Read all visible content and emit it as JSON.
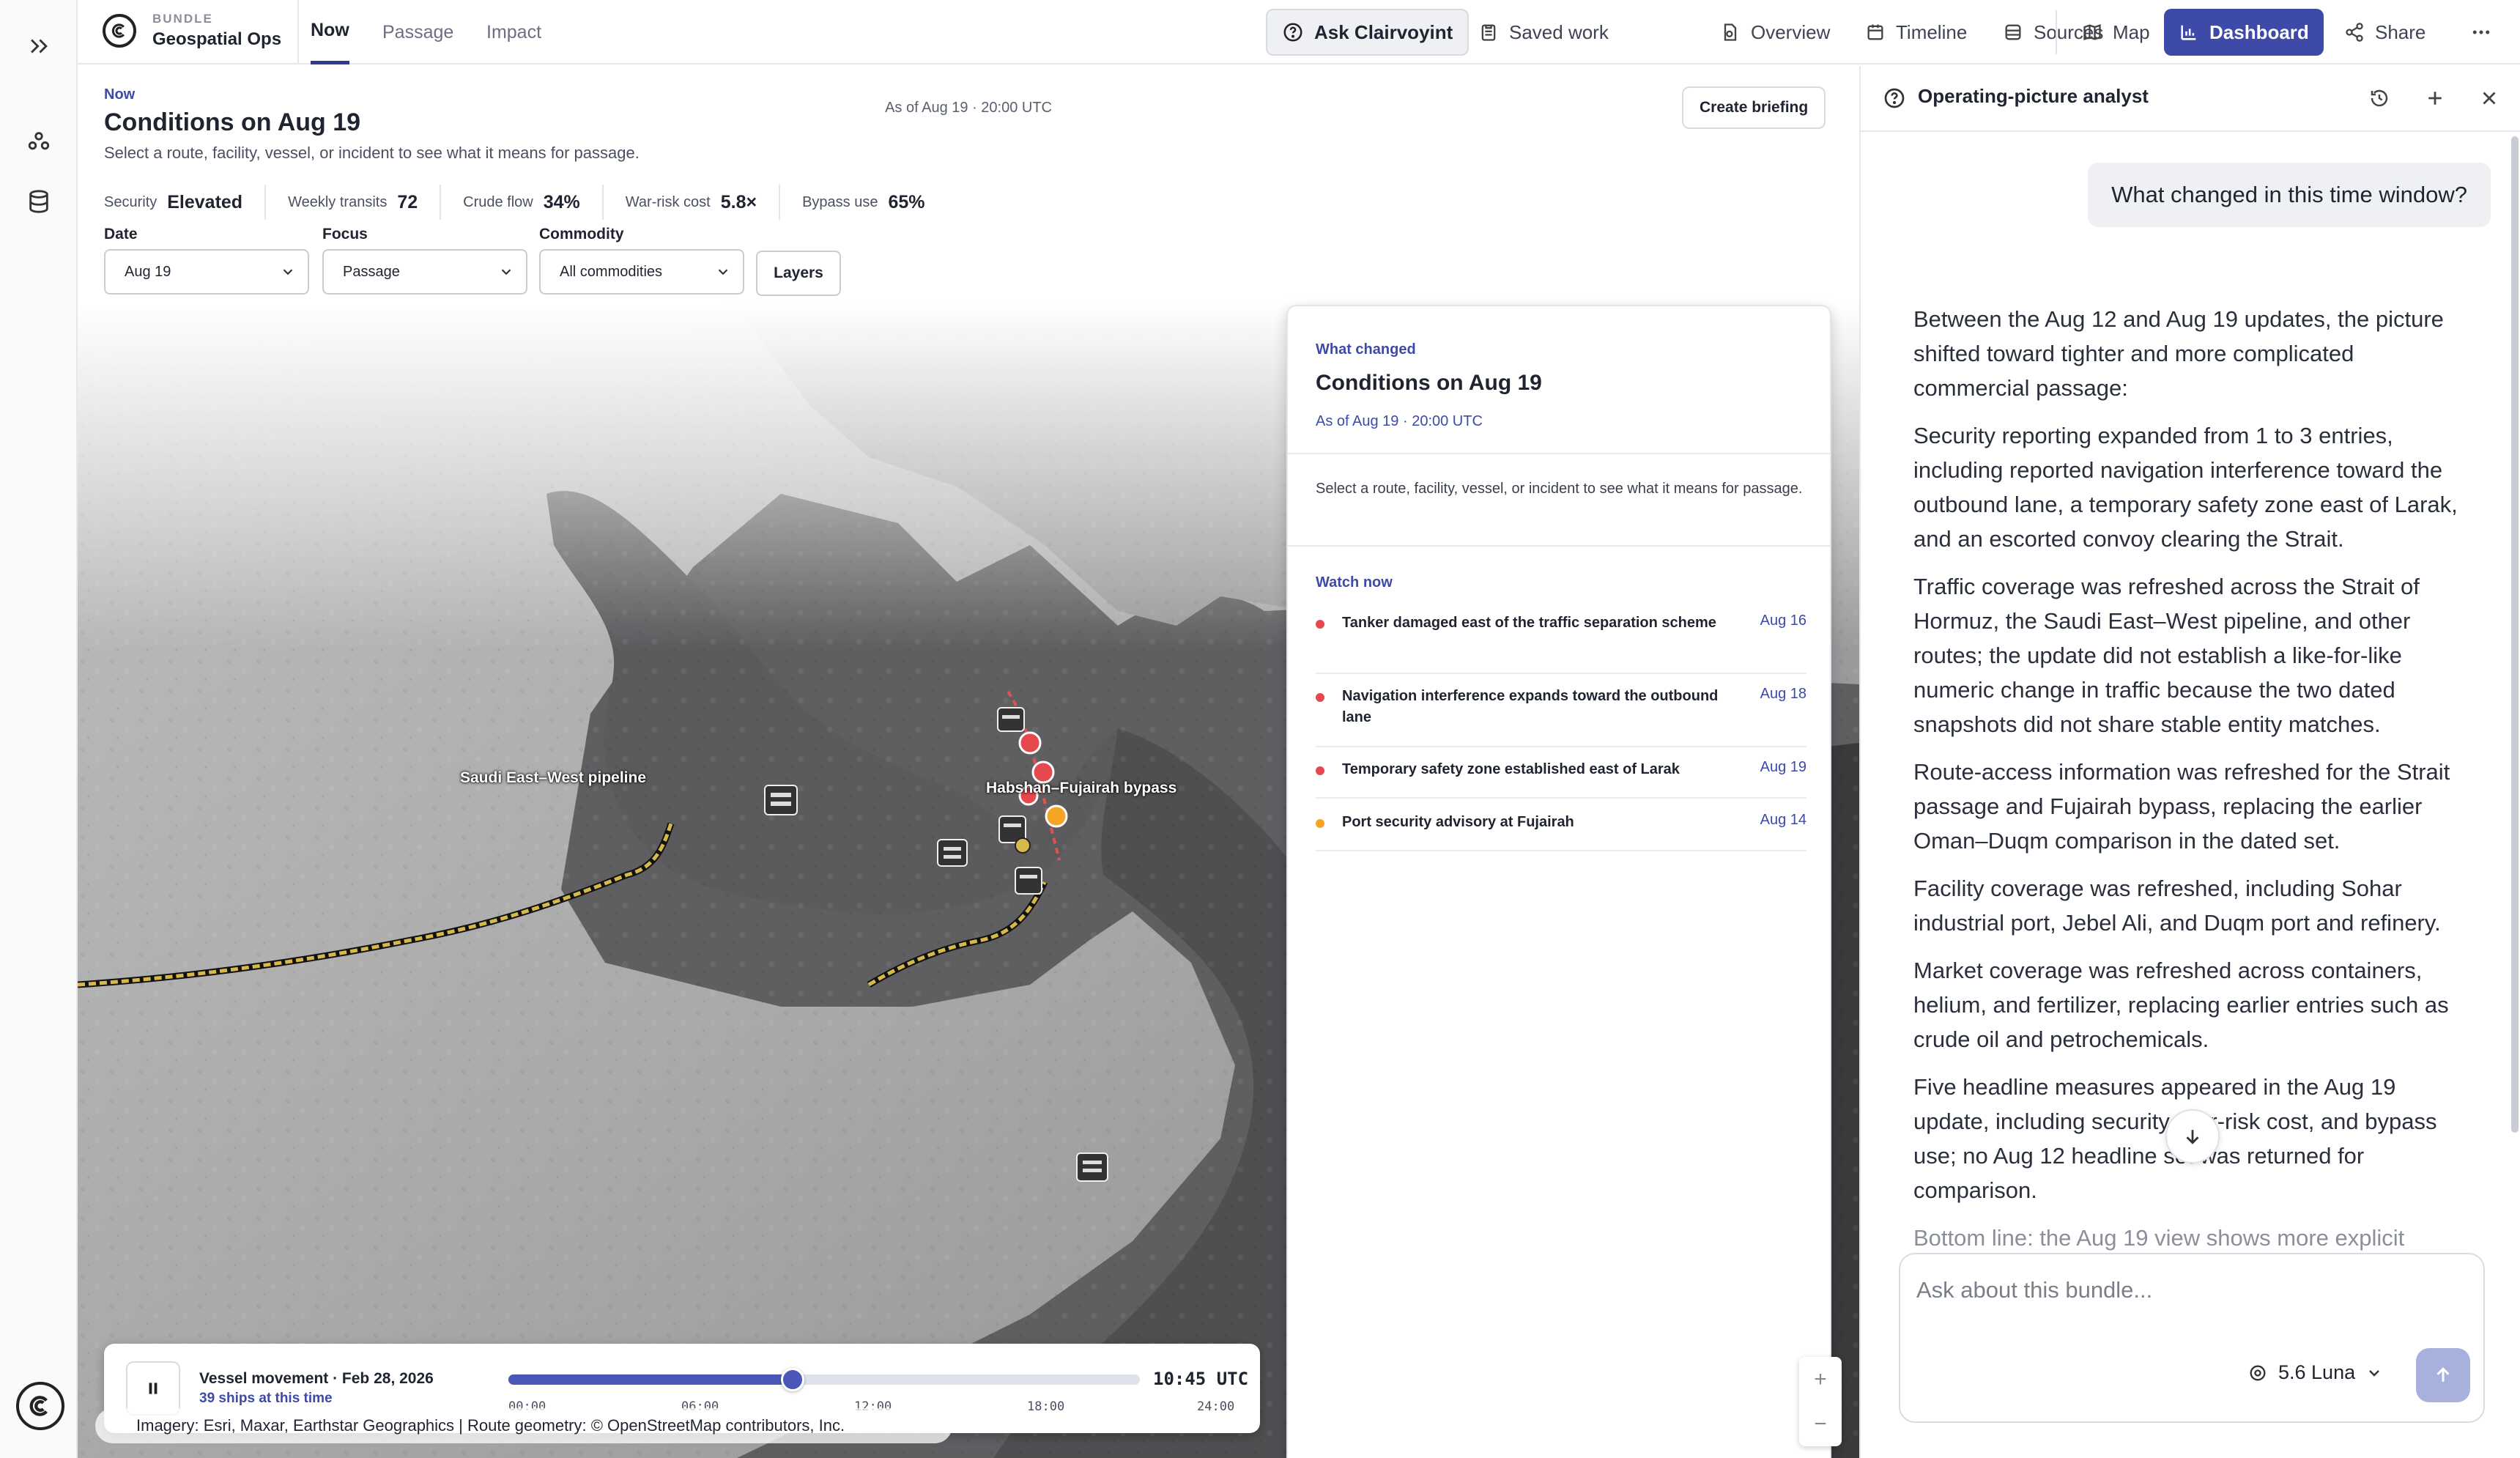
{
  "topbar": {
    "bundle_label": "BUNDLE",
    "bundle_name": "Geospatial Ops",
    "tabs": [
      {
        "label": "Now",
        "active": true
      },
      {
        "label": "Passage",
        "active": false
      },
      {
        "label": "Impact",
        "active": false
      }
    ],
    "tools": {
      "ask": "Ask Clairvoyint",
      "saved": "Saved work",
      "overview": "Overview",
      "timeline": "Timeline",
      "sources": "Sources",
      "map": "Map",
      "dashboard": "Dashboard",
      "share": "Share"
    }
  },
  "header": {
    "kicker": "Now",
    "title": "Conditions on Aug 19",
    "description": "Select a route, facility, vessel, or incident to see what it means for passage.",
    "as_of": "As of Aug 19 · 20:00 UTC",
    "create_label": "Create briefing"
  },
  "metrics": [
    {
      "label": "Security",
      "value": "Elevated"
    },
    {
      "label": "Weekly transits",
      "value": "72"
    },
    {
      "label": "Crude flow",
      "value": "34%"
    },
    {
      "label": "War-risk cost",
      "value": "5.8×"
    },
    {
      "label": "Bypass use",
      "value": "65%"
    }
  ],
  "filters": {
    "date": {
      "label": "Date",
      "value": "Aug 19"
    },
    "focus": {
      "label": "Focus",
      "value": "Passage"
    },
    "commodity": {
      "label": "Commodity",
      "value": "All commodities"
    },
    "layers_label": "Layers"
  },
  "map": {
    "labels": {
      "pipeline": "Saudi East–West pipeline",
      "bypass": "Habshan–Fujairah bypass"
    },
    "attribution": "Imagery: Esri, Maxar, Earthstar Geographics | Route geometry: © OpenStreetMap contributors, Inc."
  },
  "what_changed": {
    "kicker": "What changed",
    "title": "Conditions on Aug 19",
    "as_of": "As of Aug 19 · 20:00 UTC",
    "description": "Select a route, facility, vessel, or incident to see what it means for passage.",
    "watch_label": "Watch now",
    "items": [
      {
        "text": "Tanker damaged east of the traffic separation scheme",
        "date": "Aug 16",
        "color": "#e5484d"
      },
      {
        "text": "Navigation interference expands toward the outbound lane",
        "date": "Aug 18",
        "color": "#e5484d"
      },
      {
        "text": "Temporary safety zone established east of Larak",
        "date": "Aug 19",
        "color": "#e5484d"
      },
      {
        "text": "Port security advisory at Fujairah",
        "date": "Aug 14",
        "color": "#f5a524"
      }
    ]
  },
  "timeline": {
    "title": "Vessel movement · Feb 28, 2026",
    "subtitle": "39 ships at this time",
    "time": "10:45 UTC",
    "progress": 0.45,
    "ticks": [
      "00:00",
      "06:00",
      "12:00",
      "18:00",
      "24:00"
    ]
  },
  "assistant": {
    "title": "Operating-picture analyst",
    "question": "What changed in this time window?",
    "paragraphs": [
      "Between the Aug 12 and Aug 19 updates, the picture shifted toward tighter and more complicated commercial passage:",
      "Security reporting expanded from 1 to 3 entries, including reported navigation interference toward the outbound lane, a temporary safety zone east of Larak, and an escorted convoy clearing the Strait.",
      "Traffic coverage was refreshed across the Strait of Hormuz, the Saudi East–West pipeline, and other routes; the update did not establish a like-for-like numeric change in traffic because the two dated snapshots did not share stable entity matches.",
      "Route-access information was refreshed for the Strait passage and Fujairah bypass, replacing the earlier Oman–Duqm comparison in the dated set.",
      "Facility coverage was refreshed, including Sohar industrial port, Jebel Ali, and Duqm port and refinery.",
      "Market coverage was refreshed across containers, helium, and fertilizer, replacing earlier entries such as crude oil and petrochemicals.",
      "Five headline measures appeared in the Aug 19 update, including security, war-risk cost, and bypass use; no Aug 12 headline set was returned for comparison.",
      "Bottom line: the Aug 19 view shows more explicit"
    ],
    "composer_placeholder": "Ask about this bundle...",
    "model": "5.6 Luna"
  }
}
